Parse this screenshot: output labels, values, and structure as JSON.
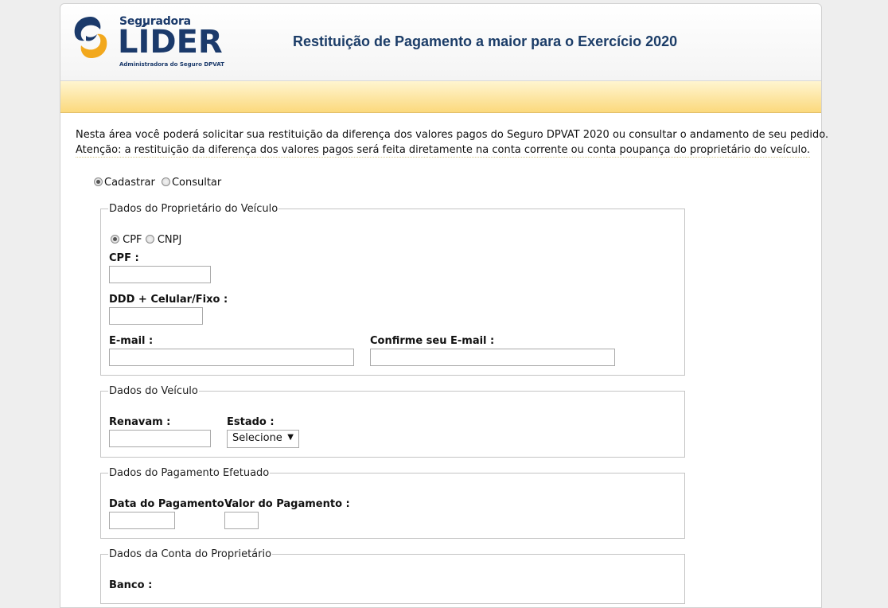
{
  "header": {
    "logo": {
      "brand_top": "Seguradora",
      "brand_main": "LÍDER",
      "brand_sub": "Administradora do Seguro DPVAT"
    },
    "title": "Restituição de Pagamento a maior para o Exercício 2020"
  },
  "intro": {
    "line1": "Nesta área você poderá solicitar sua restituição da diferença dos valores pagos do Seguro DPVAT 2020 ou consultar o andamento de seu pedido.",
    "line2": "Atenção: a restituição da diferença dos valores pagos será feita diretamente na conta corrente ou conta poupança do proprietário do veículo."
  },
  "mode": {
    "options": [
      "Cadastrar",
      "Consultar"
    ],
    "selected": "Cadastrar"
  },
  "owner": {
    "legend": "Dados do Proprietário do Veículo",
    "doc_options": [
      "CPF",
      "CNPJ"
    ],
    "doc_selected": "CPF",
    "cpf_label": "CPF :",
    "cpf_value": "",
    "phone_label": "DDD + Celular/Fixo :",
    "phone_value": "",
    "email_label": "E-mail :",
    "email_value": "",
    "email_confirm_label": "Confirme seu E-mail :",
    "email_confirm_value": ""
  },
  "vehicle": {
    "legend": "Dados do Veículo",
    "renavam_label": "Renavam :",
    "renavam_value": "",
    "estado_label": "Estado :",
    "estado_selected": "Selecione"
  },
  "payment": {
    "legend": "Dados do Pagamento Efetuado",
    "date_label": "Data do Pagamento :",
    "date_value": "",
    "amount_label": "Valor do Pagamento :",
    "amount_value": ""
  },
  "account": {
    "legend": "Dados da Conta do Proprietário",
    "bank_label": "Banco :"
  },
  "colors": {
    "title": "#1c3d68",
    "logo_blue": "#1b3a6b",
    "logo_orange": "#f2a81d",
    "band_top": "#fff5d0",
    "band_bottom": "#fbd97d"
  }
}
